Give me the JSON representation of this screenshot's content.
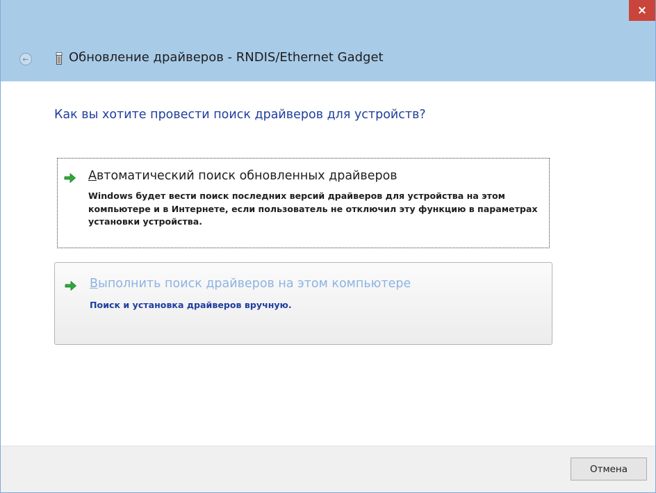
{
  "window": {
    "title": "Обновление драйверов - RNDIS/Ethernet Gadget",
    "close_label": "×"
  },
  "question": "Как вы хотите провести поиск драйверов для устройств?",
  "options": [
    {
      "title_accel": "А",
      "title_rest": "втоматический поиск обновленных драйверов",
      "description": "Windows будет вести поиск последних версий драйверов для устройства на этом компьютере и в Интернете, если пользователь не отключил эту функцию в параметрах установки устройства.",
      "icon": "green-arrow-icon"
    },
    {
      "title_accel": "В",
      "title_rest": "ыполнить поиск драйверов на этом компьютере",
      "description": "Поиск и установка драйверов вручную.",
      "icon": "green-arrow-icon"
    }
  ],
  "footer": {
    "cancel_label": "Отмена"
  },
  "colors": {
    "titlebar": "#a8cbe8",
    "close": "#c9443a",
    "heading_blue": "#1f3f9e",
    "link_hover": "#8db3e2"
  }
}
